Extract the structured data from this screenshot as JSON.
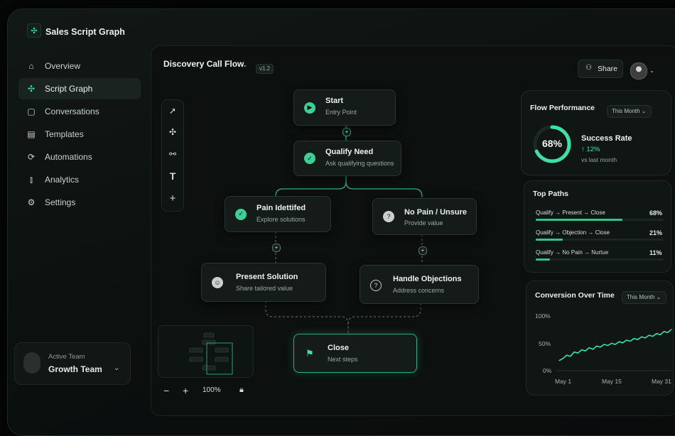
{
  "app": {
    "title": "Sales Script Graph"
  },
  "sidebar": {
    "items": [
      {
        "label": "Overview",
        "icon": "home-icon"
      },
      {
        "label": "Script Graph",
        "icon": "graph-icon",
        "active": true
      },
      {
        "label": "Conversations",
        "icon": "chat-icon"
      },
      {
        "label": "Templates",
        "icon": "template-icon"
      },
      {
        "label": "Automations",
        "icon": "automation-icon"
      },
      {
        "label": "Analytics",
        "icon": "analytics-icon"
      },
      {
        "label": "Settings",
        "icon": "gear-icon"
      }
    ],
    "team": {
      "caption": "Active Team",
      "name": "Growth Team"
    }
  },
  "header": {
    "flow_title": "Discovery Call Flow",
    "version": "v1.2",
    "share_label": "Share"
  },
  "canvas": {
    "nodes": [
      {
        "id": "start",
        "title": "Start",
        "subtitle": "Entry Point",
        "icon": "play-icon"
      },
      {
        "id": "qualify",
        "title": "Qualify Need",
        "subtitle": "Ask qualifying questions",
        "icon": "check-icon"
      },
      {
        "id": "pain",
        "title": "Pain Idettifed",
        "subtitle": "Explore solutions",
        "icon": "check-icon"
      },
      {
        "id": "nopain",
        "title": "No Pain / Unsure",
        "subtitle": "Provide value",
        "icon": "question-icon"
      },
      {
        "id": "present",
        "title": "Present Solution",
        "subtitle": "Share tailored value",
        "icon": "smile-icon"
      },
      {
        "id": "handle",
        "title": "Handle Objections",
        "subtitle": "Address concerns",
        "icon": "question-icon"
      },
      {
        "id": "close",
        "title": "Close",
        "subtitle": "Next steps",
        "icon": "flag-icon"
      }
    ],
    "zoom": "100%"
  },
  "performance": {
    "title": "Flow Performance",
    "period": "This Month",
    "rate": "68%",
    "rate_fraction": 0.68,
    "label": "Success Rate",
    "delta": "↑ 12%",
    "delta_note": "vs last month"
  },
  "top_paths": {
    "title": "Top Paths",
    "rows": [
      {
        "label": "Qualify → Present → Close",
        "value": "68%",
        "fraction": 0.68
      },
      {
        "label": "Qualify → Objection → Close",
        "value": "21%",
        "fraction": 0.21
      },
      {
        "label": "Qualify → No Pain → Nurtue",
        "value": "11%",
        "fraction": 0.11
      }
    ]
  },
  "conversion": {
    "title": "Conversion Over Time",
    "period": "This Month",
    "y_ticks": [
      "100%",
      "50%",
      "0%"
    ],
    "x_ticks": [
      "May 1",
      "May 15",
      "May 31"
    ]
  },
  "chart_data": {
    "type": "line",
    "title": "Conversion Over Time",
    "x": [
      1,
      2,
      3,
      4,
      5,
      6,
      7,
      8,
      9,
      10,
      11,
      12,
      13,
      14,
      15,
      16,
      17,
      18,
      19,
      20,
      21,
      22,
      23,
      24,
      25,
      26,
      27,
      28,
      29,
      30,
      31
    ],
    "values": [
      16,
      20,
      26,
      24,
      32,
      30,
      36,
      34,
      40,
      37,
      43,
      41,
      46,
      44,
      48,
      46,
      51,
      49,
      54,
      52,
      57,
      55,
      60,
      58,
      63,
      61,
      66,
      64,
      70,
      68,
      74
    ],
    "ylim": [
      0,
      100
    ],
    "accent": "#3ee0a6"
  },
  "colors": {
    "accent": "#3ee0a6",
    "background": "#0c110f"
  }
}
